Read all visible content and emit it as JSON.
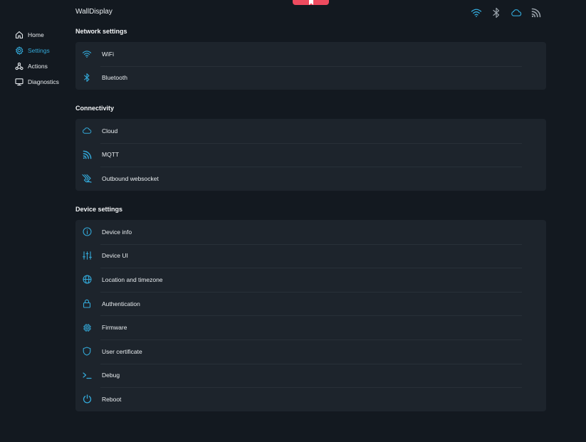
{
  "app": {
    "title": "WallDisplay",
    "accent_color": "#33a9d9",
    "top_tab_color": "#ee4b5f"
  },
  "header": {
    "status_icons": [
      "wifi-icon",
      "bluetooth-icon",
      "cloud-icon",
      "rss-icon"
    ]
  },
  "sidebar": {
    "items": [
      {
        "label": "Home",
        "icon": "home-icon",
        "active": false
      },
      {
        "label": "Settings",
        "icon": "gear-icon",
        "active": true
      },
      {
        "label": "Actions",
        "icon": "actions-icon",
        "active": false
      },
      {
        "label": "Diagnostics",
        "icon": "monitor-icon",
        "active": false
      }
    ]
  },
  "sections": [
    {
      "title": "Network settings",
      "items": [
        {
          "label": "WiFi",
          "icon": "wifi-icon"
        },
        {
          "label": "Bluetooth",
          "icon": "bluetooth-icon"
        }
      ]
    },
    {
      "title": "Connectivity",
      "items": [
        {
          "label": "Cloud",
          "icon": "cloud-icon"
        },
        {
          "label": "MQTT",
          "icon": "rss-icon"
        },
        {
          "label": "Outbound websocket",
          "icon": "websocket-icon"
        }
      ]
    },
    {
      "title": "Device settings",
      "items": [
        {
          "label": "Device info",
          "icon": "info-icon"
        },
        {
          "label": "Device UI",
          "icon": "sliders-icon"
        },
        {
          "label": "Location and timezone",
          "icon": "globe-icon"
        },
        {
          "label": "Authentication",
          "icon": "lock-icon"
        },
        {
          "label": "Firmware",
          "icon": "chip-icon"
        },
        {
          "label": "User certificate",
          "icon": "shield-icon"
        },
        {
          "label": "Debug",
          "icon": "terminal-icon"
        },
        {
          "label": "Reboot",
          "icon": "power-icon"
        }
      ]
    }
  ]
}
